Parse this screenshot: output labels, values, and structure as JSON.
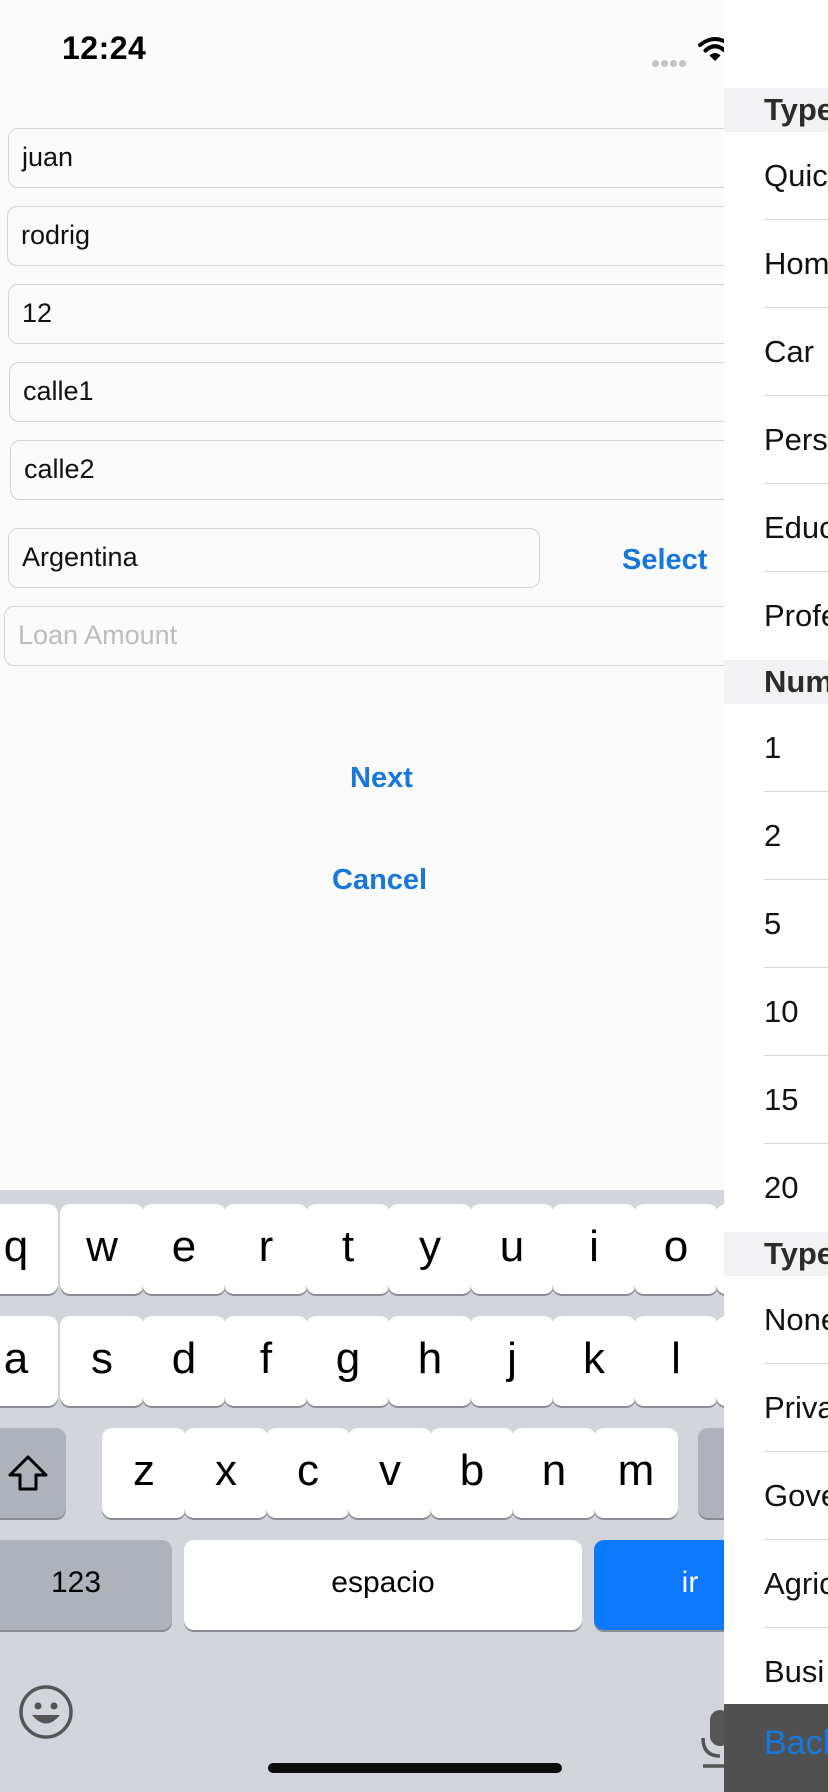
{
  "status_bar": {
    "time": "12:24"
  },
  "form": {
    "first_name": "juan",
    "last_name": "rodrig",
    "number": "12",
    "address1": "calle1",
    "address2": "calle2",
    "country": "Argentina",
    "select_label": "Select",
    "loan_amount_placeholder": "Loan Amount",
    "next_label": "Next",
    "cancel_label": "Cancel"
  },
  "keyboard": {
    "row1": [
      "q",
      "w",
      "e",
      "r",
      "t",
      "y",
      "u",
      "i",
      "o"
    ],
    "row2": [
      "a",
      "s",
      "d",
      "f",
      "g",
      "h",
      "j",
      "k",
      "l"
    ],
    "row3": [
      "z",
      "x",
      "c",
      "v",
      "b",
      "n",
      "m"
    ],
    "numbers_key": "123",
    "space_key": "espacio",
    "go_key": "ir",
    "shift_icon": "shift-arrow-icon",
    "emoji_icon": "emoji-face-icon",
    "mic_icon": "microphone-icon"
  },
  "sheet": {
    "sections": [
      {
        "header": "Type",
        "rows": [
          "Quic",
          "Hom",
          "Car",
          "Pers",
          "Educ",
          "Profe"
        ]
      },
      {
        "header": "Num",
        "rows": [
          "1",
          "2",
          "5",
          "10",
          "15",
          "20"
        ]
      },
      {
        "header": "Type",
        "rows": [
          "None",
          "Priva",
          "Gove",
          "Agric",
          "Busi"
        ]
      }
    ],
    "back_label": "Back"
  },
  "colors": {
    "accent": "#1677dc",
    "go_key": "#0b78fe",
    "keyboard_bg": "#d2d5db"
  }
}
